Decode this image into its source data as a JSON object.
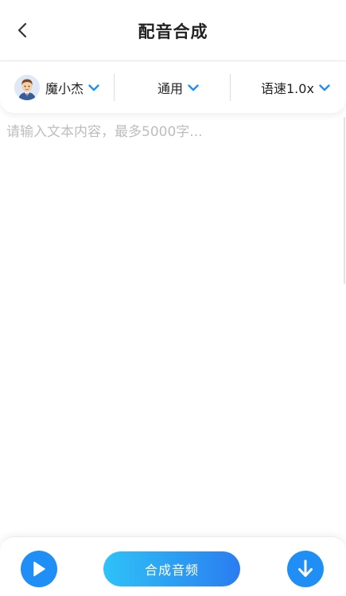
{
  "header": {
    "title": "配音合成",
    "back_icon": "chevron-left-icon"
  },
  "options": {
    "voice": {
      "name": "魔小杰",
      "avatar": "avatar-icon",
      "icon": "chevron-down-icon"
    },
    "style": {
      "label": "通用",
      "icon": "chevron-down-icon"
    },
    "speed": {
      "label": "语速1.0x",
      "icon": "chevron-down-icon"
    }
  },
  "editor": {
    "placeholder": "请输入文本内容，最多5000字...",
    "value": ""
  },
  "bottom_bar": {
    "play_icon": "play-icon",
    "synthesize_label": "合成音频",
    "download_icon": "download-icon"
  },
  "colors": {
    "accent": "#1f8ff5",
    "gradient_start": "#2fc2f7",
    "gradient_end": "#2a7df0",
    "placeholder": "#bdbdbd"
  }
}
